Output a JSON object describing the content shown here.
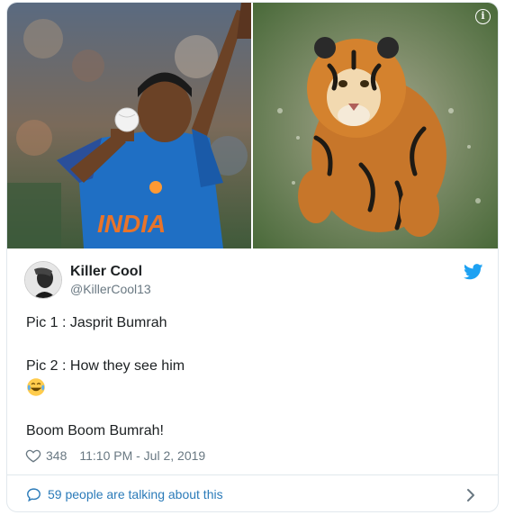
{
  "media": {
    "left_photo": "cricket-bowler-photo",
    "left_jersey_text": "INDIA",
    "right_photo": "tiger-photo",
    "info_icon": "info-icon"
  },
  "author": {
    "name": "Killer Cool",
    "handle": "@KillerCool13",
    "avatar": "avatar"
  },
  "tweet": {
    "line1": "Pic 1 : Jasprit Bumrah",
    "line2": "Pic 2 : How they see him",
    "emoji": "face-with-tears-of-joy",
    "line3": "Boom Boom Bumrah!"
  },
  "meta": {
    "likes": "348",
    "timestamp": "11:10 PM - Jul 2, 2019"
  },
  "footer": {
    "talking": "59 people are talking about this"
  },
  "colors": {
    "twitter_blue": "#1da1f2",
    "link_blue": "#2b7bb9",
    "muted_gray": "#697882",
    "border": "#e1e8ed"
  }
}
